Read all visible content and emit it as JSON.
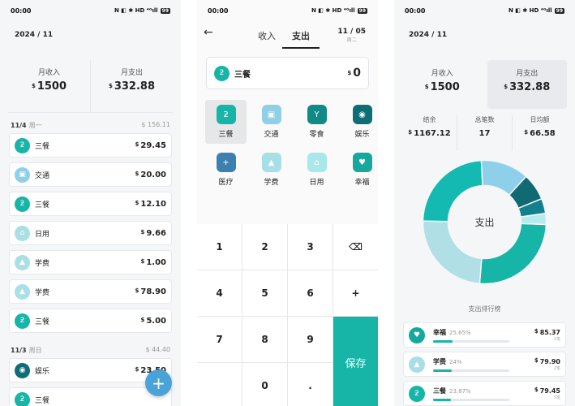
{
  "status": {
    "time": "00:00",
    "battery": "99",
    "icons": "N ◧ ✱ HD ⁴ᴳıll"
  },
  "screen1": {
    "month": "2024 / 11",
    "income_label": "月收入",
    "income_value": "1500",
    "expense_label": "月支出",
    "expense_value": "332.88",
    "currency": "$",
    "days": [
      {
        "date": "11/4",
        "weekday": "周一",
        "total": "156.11",
        "rows": [
          {
            "name": "三餐",
            "amount": "29.45",
            "icon": "meal-icon",
            "color": "#16b5a8"
          },
          {
            "name": "交通",
            "amount": "20.00",
            "icon": "bus-icon",
            "color": "#8fd0e8"
          },
          {
            "name": "三餐",
            "amount": "12.10",
            "icon": "meal-icon",
            "color": "#16b5a8"
          },
          {
            "name": "日用",
            "amount": "9.66",
            "icon": "home-icon",
            "color": "#a8e0e6"
          },
          {
            "name": "学费",
            "amount": "1.00",
            "icon": "graduation-icon",
            "color": "#a8e0e6"
          },
          {
            "name": "学费",
            "amount": "78.90",
            "icon": "graduation-icon",
            "color": "#a8e0e6"
          },
          {
            "name": "三餐",
            "amount": "5.00",
            "icon": "meal-icon",
            "color": "#16b5a8"
          }
        ]
      },
      {
        "date": "11/3",
        "weekday": "周日",
        "total": "44.40",
        "rows": [
          {
            "name": "娱乐",
            "amount": "23.50",
            "icon": "gamepad-icon",
            "color": "#0f6e75"
          },
          {
            "name": "三餐",
            "amount": "",
            "icon": "meal-icon",
            "color": "#16b5a8"
          }
        ]
      }
    ],
    "fab_label": "+"
  },
  "screen2": {
    "back": "←",
    "tab_income": "收入",
    "tab_expense": "支出",
    "date": "11 / 05",
    "weekday": "周二",
    "entry_name": "三餐",
    "entry_currency": "$",
    "entry_amount": "0",
    "categories": [
      {
        "name": "三餐",
        "icon": "meal-icon",
        "color": "#16b5a8",
        "glyph": "ƻ"
      },
      {
        "name": "交通",
        "icon": "bus-icon",
        "color": "#8fd0e8",
        "glyph": "▣"
      },
      {
        "name": "零食",
        "icon": "cocktail-icon",
        "color": "#0f8a87",
        "glyph": "Y"
      },
      {
        "name": "娱乐",
        "icon": "gamepad-icon",
        "color": "#0f6e75",
        "glyph": "◉"
      },
      {
        "name": "医疗",
        "icon": "medical-icon",
        "color": "#3d7fb0",
        "glyph": "+"
      },
      {
        "name": "学费",
        "icon": "graduation-icon",
        "color": "#a8dfe7",
        "glyph": "▲"
      },
      {
        "name": "日用",
        "icon": "home-icon",
        "color": "#a8e7ea",
        "glyph": "⌂"
      },
      {
        "name": "幸福",
        "icon": "heart-icon",
        "color": "#15a99e",
        "glyph": "♥"
      }
    ],
    "keys": [
      "1",
      "2",
      "3",
      "⌫",
      "4",
      "5",
      "6",
      "+",
      "7",
      "8",
      "9",
      "",
      "0",
      "."
    ],
    "save_label": "保存"
  },
  "screen3": {
    "month": "2024 / 11",
    "income_label": "月收入",
    "income_value": "1500",
    "expense_label": "月支出",
    "expense_value": "332.88",
    "balance_label": "结余",
    "balance_value": "1167.12",
    "count_label": "总笔数",
    "count_value": "17",
    "daily_label": "日均额",
    "daily_value": "66.58",
    "donut_center": "支出",
    "rank_title": "支出排行榜",
    "ranks": [
      {
        "name": "幸福",
        "pct": "25.65%",
        "frac": 0.2565,
        "amount": "85.37",
        "count": "1笔",
        "icon": "heart-icon",
        "color": "#15a99e"
      },
      {
        "name": "学费",
        "pct": "24%",
        "frac": 0.24,
        "amount": "79.90",
        "count": "2笔",
        "icon": "graduation-icon",
        "color": "#a8dfe7"
      },
      {
        "name": "三餐",
        "pct": "23.87%",
        "frac": 0.2387,
        "amount": "79.45",
        "count": "5笔",
        "icon": "meal-icon",
        "color": "#16b5a8"
      }
    ]
  },
  "chart_data": {
    "type": "pie",
    "title": "",
    "categories": [
      "幸福",
      "学费",
      "三餐",
      "交通",
      "娱乐",
      "零食",
      "日用"
    ],
    "values": [
      85.37,
      79.9,
      79.45,
      42.0,
      23.5,
      13.0,
      9.66
    ],
    "colors": [
      "#16b5a8",
      "#b0dfe5",
      "#14bab1",
      "#8ecfea",
      "#0f6a72",
      "#137f8f",
      "#b5ebef"
    ]
  }
}
